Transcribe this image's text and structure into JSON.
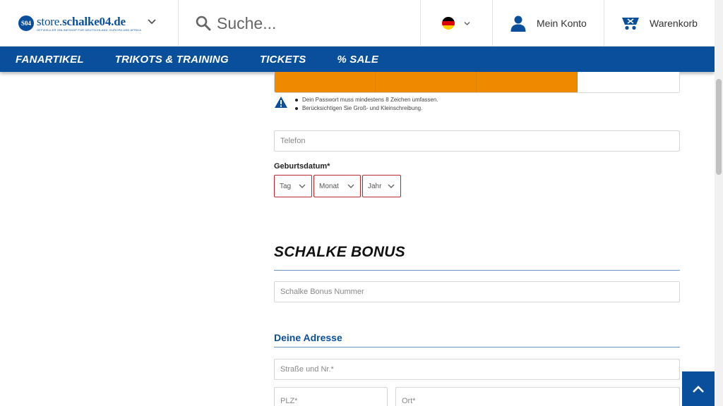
{
  "header": {
    "logo_prefix": "store.",
    "logo_bold": "schalke04.de",
    "logo_tagline": "OFFIZIELLER ONLINESHOP FÜR DEUTSCHLAND, EUROPA UND AFRIKA",
    "search_placeholder": "Suche...",
    "language": "Deutsch",
    "account_label": "Mein Konto",
    "cart_label": "Warenkorb"
  },
  "nav": {
    "items": [
      {
        "label": "Fanartikel"
      },
      {
        "label": "Trikots & Training"
      },
      {
        "label": "Tickets"
      },
      {
        "label": "% Sale"
      }
    ]
  },
  "password": {
    "strength_level": 0.75,
    "hints": [
      "Dein Passwort muss mindestens 8 Zeichen umfassen.",
      "Berücksichtigen Sie Groß- und Kleinschreibung."
    ]
  },
  "form": {
    "phone_placeholder": "Telefon",
    "dob_label": "Geburtsdatum*",
    "dob_day": "Tag",
    "dob_month": "Monat",
    "dob_year": "Jahr",
    "bonus_title": "SCHALKE BONUS",
    "bonus_placeholder": "Schalke Bonus Nummer",
    "address_title": "Deine Adresse",
    "street_placeholder": "Straße und Nr.*",
    "zip_placeholder": "PLZ*",
    "city_placeholder": "Ort*"
  },
  "colors": {
    "brand_blue": "#0a4f9c",
    "strength_orange": "#ef8a00",
    "error_red": "#b7282e"
  }
}
